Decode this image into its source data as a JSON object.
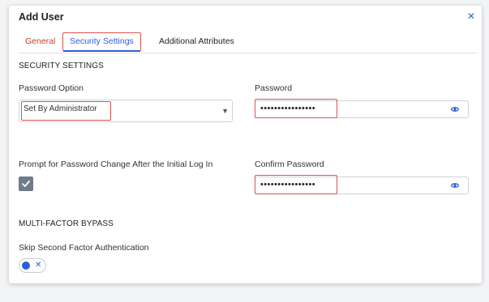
{
  "dialog": {
    "title": "Add User",
    "close_icon": "close-icon"
  },
  "tabs": [
    {
      "label": "General",
      "active": false
    },
    {
      "label": "Security Settings",
      "active": true
    },
    {
      "label": "Additional Attributes",
      "active": false
    }
  ],
  "security": {
    "section_title": "SECURITY SETTINGS",
    "password_option_label": "Password Option",
    "password_option_value": "Set By Administrator",
    "password_label": "Password",
    "password_value": "••••••••••••••••",
    "prompt_change_label": "Prompt for Password Change After the Initial Log In",
    "prompt_change_checked": true,
    "confirm_password_label": "Confirm Password",
    "confirm_password_value": "••••••••••••••••"
  },
  "mfa": {
    "section_title": "MULTI-FACTOR BYPASS",
    "skip_label": "Skip Second Factor Authentication",
    "skip_enabled": false
  },
  "colors": {
    "accent": "#2b5fd9",
    "highlight": "#d9534f",
    "checkbox": "#6f7b8b"
  },
  "icons": {
    "select_caret": "chevron-down-icon",
    "reveal": "eye-icon",
    "check": "check-icon",
    "toggle_off": "close-icon"
  }
}
